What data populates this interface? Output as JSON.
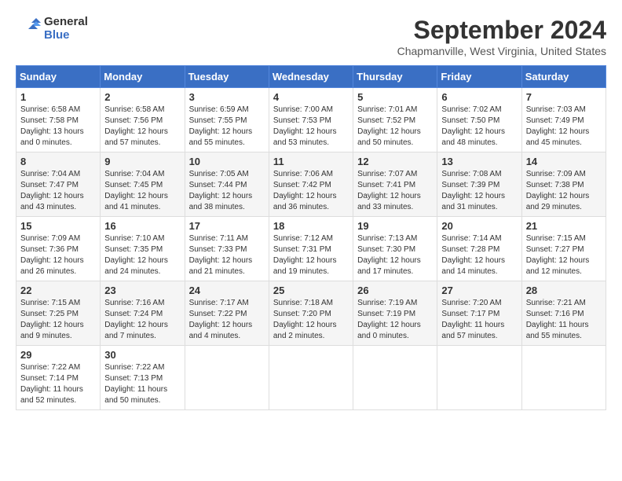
{
  "logo": {
    "line1": "General",
    "line2": "Blue"
  },
  "title": "September 2024",
  "location": "Chapmanville, West Virginia, United States",
  "days_of_week": [
    "Sunday",
    "Monday",
    "Tuesday",
    "Wednesday",
    "Thursday",
    "Friday",
    "Saturday"
  ],
  "weeks": [
    [
      {
        "day": "1",
        "sunrise": "6:58 AM",
        "sunset": "7:58 PM",
        "daylight": "13 hours and 0 minutes."
      },
      {
        "day": "2",
        "sunrise": "6:58 AM",
        "sunset": "7:56 PM",
        "daylight": "12 hours and 57 minutes."
      },
      {
        "day": "3",
        "sunrise": "6:59 AM",
        "sunset": "7:55 PM",
        "daylight": "12 hours and 55 minutes."
      },
      {
        "day": "4",
        "sunrise": "7:00 AM",
        "sunset": "7:53 PM",
        "daylight": "12 hours and 53 minutes."
      },
      {
        "day": "5",
        "sunrise": "7:01 AM",
        "sunset": "7:52 PM",
        "daylight": "12 hours and 50 minutes."
      },
      {
        "day": "6",
        "sunrise": "7:02 AM",
        "sunset": "7:50 PM",
        "daylight": "12 hours and 48 minutes."
      },
      {
        "day": "7",
        "sunrise": "7:03 AM",
        "sunset": "7:49 PM",
        "daylight": "12 hours and 45 minutes."
      }
    ],
    [
      {
        "day": "8",
        "sunrise": "7:04 AM",
        "sunset": "7:47 PM",
        "daylight": "12 hours and 43 minutes."
      },
      {
        "day": "9",
        "sunrise": "7:04 AM",
        "sunset": "7:45 PM",
        "daylight": "12 hours and 41 minutes."
      },
      {
        "day": "10",
        "sunrise": "7:05 AM",
        "sunset": "7:44 PM",
        "daylight": "12 hours and 38 minutes."
      },
      {
        "day": "11",
        "sunrise": "7:06 AM",
        "sunset": "7:42 PM",
        "daylight": "12 hours and 36 minutes."
      },
      {
        "day": "12",
        "sunrise": "7:07 AM",
        "sunset": "7:41 PM",
        "daylight": "12 hours and 33 minutes."
      },
      {
        "day": "13",
        "sunrise": "7:08 AM",
        "sunset": "7:39 PM",
        "daylight": "12 hours and 31 minutes."
      },
      {
        "day": "14",
        "sunrise": "7:09 AM",
        "sunset": "7:38 PM",
        "daylight": "12 hours and 29 minutes."
      }
    ],
    [
      {
        "day": "15",
        "sunrise": "7:09 AM",
        "sunset": "7:36 PM",
        "daylight": "12 hours and 26 minutes."
      },
      {
        "day": "16",
        "sunrise": "7:10 AM",
        "sunset": "7:35 PM",
        "daylight": "12 hours and 24 minutes."
      },
      {
        "day": "17",
        "sunrise": "7:11 AM",
        "sunset": "7:33 PM",
        "daylight": "12 hours and 21 minutes."
      },
      {
        "day": "18",
        "sunrise": "7:12 AM",
        "sunset": "7:31 PM",
        "daylight": "12 hours and 19 minutes."
      },
      {
        "day": "19",
        "sunrise": "7:13 AM",
        "sunset": "7:30 PM",
        "daylight": "12 hours and 17 minutes."
      },
      {
        "day": "20",
        "sunrise": "7:14 AM",
        "sunset": "7:28 PM",
        "daylight": "12 hours and 14 minutes."
      },
      {
        "day": "21",
        "sunrise": "7:15 AM",
        "sunset": "7:27 PM",
        "daylight": "12 hours and 12 minutes."
      }
    ],
    [
      {
        "day": "22",
        "sunrise": "7:15 AM",
        "sunset": "7:25 PM",
        "daylight": "12 hours and 9 minutes."
      },
      {
        "day": "23",
        "sunrise": "7:16 AM",
        "sunset": "7:24 PM",
        "daylight": "12 hours and 7 minutes."
      },
      {
        "day": "24",
        "sunrise": "7:17 AM",
        "sunset": "7:22 PM",
        "daylight": "12 hours and 4 minutes."
      },
      {
        "day": "25",
        "sunrise": "7:18 AM",
        "sunset": "7:20 PM",
        "daylight": "12 hours and 2 minutes."
      },
      {
        "day": "26",
        "sunrise": "7:19 AM",
        "sunset": "7:19 PM",
        "daylight": "12 hours and 0 minutes."
      },
      {
        "day": "27",
        "sunrise": "7:20 AM",
        "sunset": "7:17 PM",
        "daylight": "11 hours and 57 minutes."
      },
      {
        "day": "28",
        "sunrise": "7:21 AM",
        "sunset": "7:16 PM",
        "daylight": "11 hours and 55 minutes."
      }
    ],
    [
      {
        "day": "29",
        "sunrise": "7:22 AM",
        "sunset": "7:14 PM",
        "daylight": "11 hours and 52 minutes."
      },
      {
        "day": "30",
        "sunrise": "7:22 AM",
        "sunset": "7:13 PM",
        "daylight": "11 hours and 50 minutes."
      },
      null,
      null,
      null,
      null,
      null
    ]
  ]
}
